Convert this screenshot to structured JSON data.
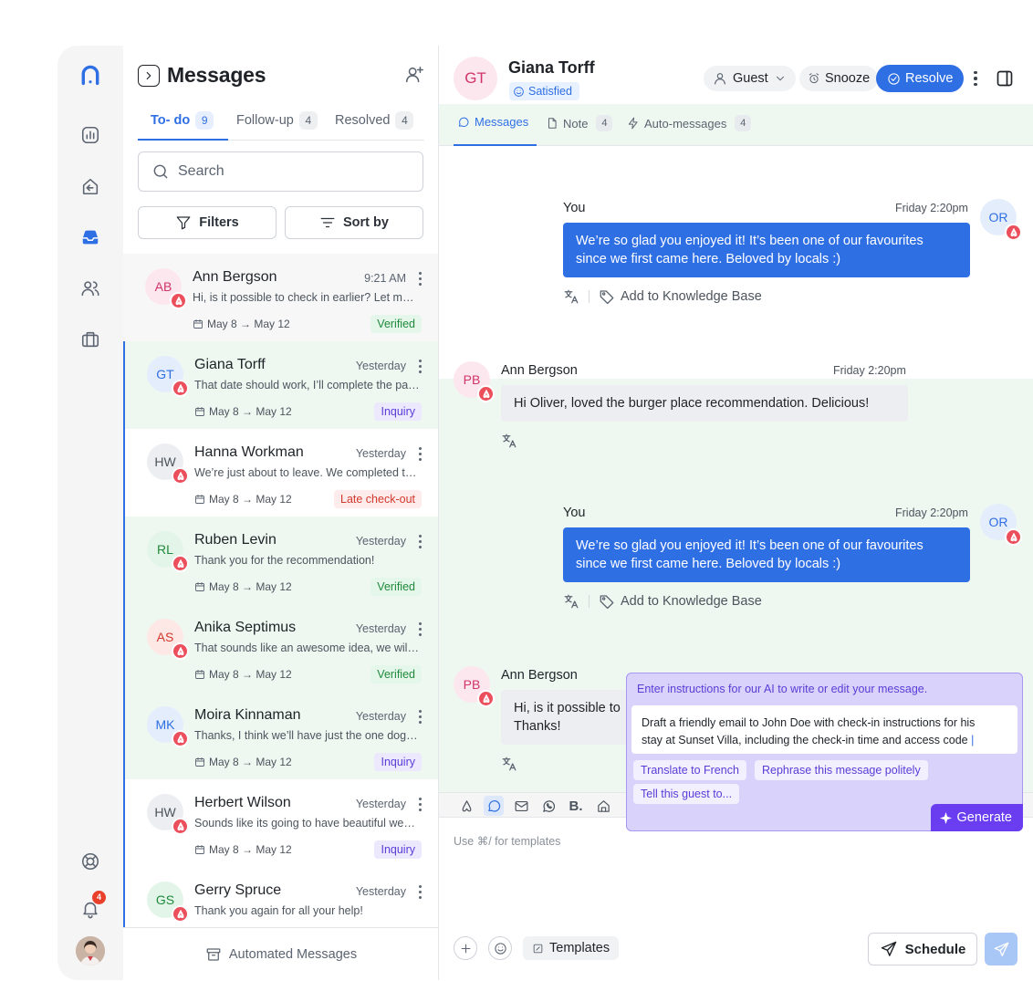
{
  "colors": {
    "accent": "#2f6fe4",
    "ai": "#6a3ef0",
    "verified": "#1f8a3b",
    "inquiry": "#5a3dd6",
    "late": "#d4382c",
    "band": "#eef8f1"
  },
  "rail": {
    "icons": [
      "logo-icon",
      "analytics-icon",
      "back-arrow-icon",
      "inbox-icon",
      "users-icon",
      "briefcase-icon",
      "support-icon",
      "bell-icon"
    ],
    "notification_count": "4"
  },
  "list": {
    "title": "Messages",
    "tabs": [
      {
        "label": "To- do",
        "count": "9"
      },
      {
        "label": "Follow-up",
        "count": "4"
      },
      {
        "label": "Resolved",
        "count": "4"
      }
    ],
    "search_placeholder": "Search",
    "filters_label": "Filters",
    "sort_label": "Sort by",
    "conversations": [
      {
        "initials": "AB",
        "name": "Ann Bergson",
        "time": "9:21 AM",
        "preview": "Hi, is it possible to check in earlier? Let me know",
        "dates": "May 8 → May 12",
        "tag": "Verified"
      },
      {
        "initials": "GT",
        "name": "Giana Torff",
        "time": "Yesterday",
        "preview": "That date should work, I’ll complete the paperwork",
        "dates": "May 8 → May 12",
        "tag": "Inquiry"
      },
      {
        "initials": "HW",
        "name": "Hanna Workman",
        "time": "Yesterday",
        "preview": "We’re just about to leave. We completed the checklist",
        "dates": "May 8 → May 12",
        "tag": "Late check-out"
      },
      {
        "initials": "RL",
        "name": "Ruben Levin",
        "time": "Yesterday",
        "preview": "Thank you for the recommendation!",
        "dates": "May 8 → May 12",
        "tag": "Verified"
      },
      {
        "initials": "AS",
        "name": "Anika Septimus",
        "time": "Yesterday",
        "preview": "That sounds like an awesome idea, we will try it",
        "dates": "May 8 → May 12",
        "tag": "Verified"
      },
      {
        "initials": "MK",
        "name": "Moira Kinnaman",
        "time": "Yesterday",
        "preview": "Thanks, I think we’ll have just the one dog with us",
        "dates": "May 8 → May 12",
        "tag": "Inquiry"
      },
      {
        "initials": "HW",
        "name": "Herbert Wilson",
        "time": "Yesterday",
        "preview": "Sounds like its going to have beautiful weather",
        "dates": "May 8 → May 12",
        "tag": "Inquiry"
      },
      {
        "initials": "GS",
        "name": "Gerry Spruce",
        "time": "Yesterday",
        "preview": "Thank you again for all your help!",
        "dates": "",
        "tag": ""
      }
    ],
    "automated_label": "Automated Messages"
  },
  "chat": {
    "initials": "GT",
    "name": "Giana Torff",
    "sentiment": "Satisfied",
    "guest_label": "Guest",
    "snooze_label": "Snooze",
    "resolve_label": "Resolve",
    "tabs": [
      {
        "label": "Messages",
        "count": ""
      },
      {
        "label": "Note",
        "count": "4"
      },
      {
        "label": "Auto-messages",
        "count": "4"
      }
    ],
    "messages": [
      {
        "sender": "You",
        "time": "Friday 2:20pm",
        "avatar": "OR",
        "line1": "We’re so glad you enjoyed it! It’s been one of our favourites",
        "line2": "since we first came here. Beloved by locals :)",
        "action": "Add to Knowledge Base"
      },
      {
        "sender": "Ann Bergson",
        "time": "Friday 2:20pm",
        "avatar": "PB",
        "line1": "Hi Oliver, loved the burger place recommendation. Delicious!"
      },
      {
        "sender": "You",
        "time": "Friday 2:20pm",
        "avatar": "OR",
        "line1": "We’re so glad you enjoyed it! It’s been one of our favourites",
        "line2": "since we first came here. Beloved by locals :)",
        "action": "Add to Knowledge Base"
      },
      {
        "sender": "Ann Bergson",
        "time": "",
        "avatar": "PB",
        "line1": "Hi, is it possible to",
        "line2": "Thanks!"
      }
    ],
    "ai": {
      "hint": "Enter instructions for our AI to write or edit your message.",
      "prompt_line1": "Draft a friendly email to John Doe with check-in instructions for his",
      "prompt_line2": "stay at Sunset Villa, including the check-in time and access code",
      "caret": "|",
      "chips": [
        "Translate to French",
        "Rephrase this message politely",
        "Tell this guest to..."
      ],
      "generate_label": "Generate"
    },
    "composer": {
      "placeholder": "Use ⌘/ for templates",
      "templates_label": "Templates",
      "schedule_label": "Schedule"
    }
  }
}
